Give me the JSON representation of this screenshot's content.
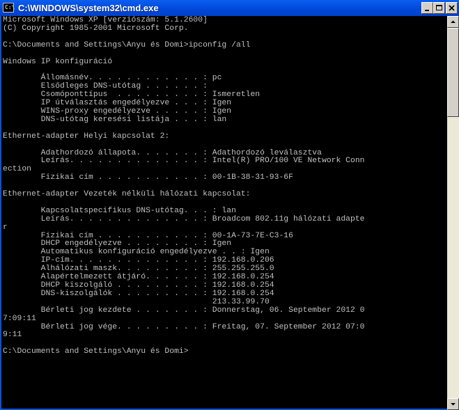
{
  "window": {
    "title": "C:\\WINDOWS\\system32\\cmd.exe",
    "icon_text": "C:\\",
    "scroll_position": 0.0
  },
  "console": {
    "lines": [
      "Microsoft Windows XP [verziószám: 5.1.2600]",
      "(C) Copyright 1985-2001 Microsoft Corp.",
      "",
      "C:\\Documents and Settings\\Anyu és Domi>ipconfig /all",
      "",
      "Windows IP konfiguráció",
      "",
      "        Állomásnév. . . . . . . . . . . . : pc",
      "        Elsődleges DNS-utótag . . . . . . :",
      "        Csomóponttípus  . . . . . . . . . : Ismeretlen",
      "        IP útválasztás engedélyezve . . . : Igen",
      "        WINS-proxy engedélyezve . . . . . : Igen",
      "        DNS-utótag keresési listája . . . : lan",
      "",
      "Ethernet-adapter Helyi kapcsolat 2:",
      "",
      "        Adathordozó állapota. . . . . . . : Adathordozó leválasztva",
      "        Leírás. . . . . . . . . . . . . . : Intel(R) PRO/100 VE Network Conn",
      "ection",
      "        Fizikai cím . . . . . . . . . . . : 00-1B-38-31-93-6F",
      "",
      "Ethernet-adapter Vezeték nélküli hálózati kapcsolat:",
      "",
      "        Kapcsolatspecifikus DNS-utótag. . . : lan",
      "        Leírás. . . . . . . . . . . . . . : Broadcom 802.11g hálózati adapte",
      "r",
      "        Fizikai cím . . . . . . . . . . . : 00-1A-73-7E-C3-16",
      "        DHCP engedélyezve . . . . . . . . : Igen",
      "        Automatikus konfiguráció engedélyezve . . : Igen",
      "        IP-cím. . . . . . . . . . . . . . : 192.168.0.206",
      "        Alhálózati maszk. . . . . . . . . : 255.255.255.0",
      "        Alapértelmezett átjáró. . . . . . : 192.168.0.254",
      "        DHCP kiszolgáló . . . . . . . . . : 192.168.0.254",
      "        DNS-kiszolgálók . . . . . . . . . : 192.168.0.254",
      "                                            213.33.99.70",
      "        Bérleti jog kezdete . . . . . . . : Donnerstag, 06. September 2012 0",
      "7:09:11",
      "        Bérleti jog vége. . . . . . . . . : Freitag, 07. September 2012 07:0",
      "9:11",
      "",
      "C:\\Documents and Settings\\Anyu és Domi>"
    ]
  }
}
